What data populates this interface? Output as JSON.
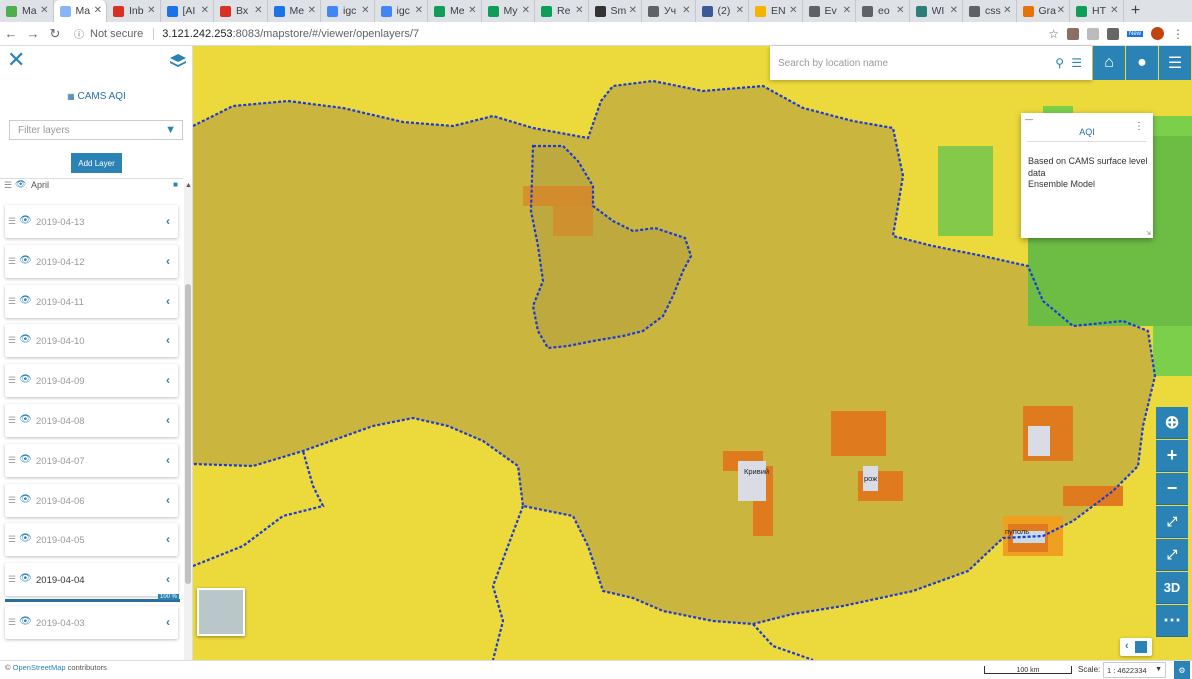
{
  "browser": {
    "tabs": [
      {
        "label": "Ma",
        "color": "#4caf50"
      },
      {
        "label": "Ma",
        "color": "#8ab4f8",
        "active": true
      },
      {
        "label": "Inb",
        "color": "#d93025"
      },
      {
        "label": "[AI",
        "color": "#1a73e8"
      },
      {
        "label": "Вх",
        "color": "#d93025"
      },
      {
        "label": "Me",
        "color": "#1a73e8"
      },
      {
        "label": "igc",
        "color": "#4285f4"
      },
      {
        "label": "igc",
        "color": "#4285f4"
      },
      {
        "label": "Me",
        "color": "#0f9d58"
      },
      {
        "label": "My",
        "color": "#0f9d58"
      },
      {
        "label": "Re",
        "color": "#0f9d58"
      },
      {
        "label": "Sm",
        "color": "#333333"
      },
      {
        "label": "Уч",
        "color": "#5f6368"
      },
      {
        "label": "(2)",
        "color": "#3b5998"
      },
      {
        "label": "EN",
        "color": "#f4b400"
      },
      {
        "label": "Ev",
        "color": "#5f6368"
      },
      {
        "label": "eo",
        "color": "#5f6368"
      },
      {
        "label": "WI",
        "color": "#2e7d76"
      },
      {
        "label": "css",
        "color": "#5f6368"
      },
      {
        "label": "Gra",
        "color": "#e8710a"
      },
      {
        "label": "HT",
        "color": "#0f9d58"
      }
    ],
    "new_tab": "+",
    "not_secure": "Not secure",
    "url_host": "3.121.242.253",
    "url_path": ":8083/mapstore/#/viewer/openlayers/7",
    "new_badge": "New"
  },
  "sidebar": {
    "title": "CAMS AQI",
    "filter_placeholder": "Filter layers",
    "add_layer": "Add Layer",
    "group": "April",
    "layers": [
      {
        "label": "2019-04-13",
        "visible": false
      },
      {
        "label": "2019-04-12",
        "visible": false
      },
      {
        "label": "2019-04-11",
        "visible": false
      },
      {
        "label": "2019-04-10",
        "visible": false
      },
      {
        "label": "2019-04-09",
        "visible": false
      },
      {
        "label": "2019-04-08",
        "visible": false
      },
      {
        "label": "2019-04-07",
        "visible": false
      },
      {
        "label": "2019-04-06",
        "visible": false
      },
      {
        "label": "2019-04-05",
        "visible": false
      },
      {
        "label": "2019-04-04",
        "visible": true
      },
      {
        "label": "2019-04-03",
        "visible": false
      }
    ],
    "opacity_label": "100 %"
  },
  "search": {
    "placeholder": "Search by location name"
  },
  "aqi_panel": {
    "title": "AQI",
    "description": "Based on CAMS surface level data",
    "model": "Ensemble Model"
  },
  "map": {
    "city_labels": [
      "Кривий",
      "Ріг",
      "рож",
      "Маріуполь",
      "пуполь"
    ],
    "nav": [
      "locate",
      "zoom-in",
      "zoom-out",
      "full-extent",
      "fullscreen",
      "3D",
      "more"
    ],
    "nav_3d": "3D"
  },
  "footer": {
    "osm": "OpenStreetMap",
    "contributors": "contributors",
    "scale_bar": "100 km",
    "scale_label": "Scale:",
    "scale_value": "1 : 4622334"
  }
}
